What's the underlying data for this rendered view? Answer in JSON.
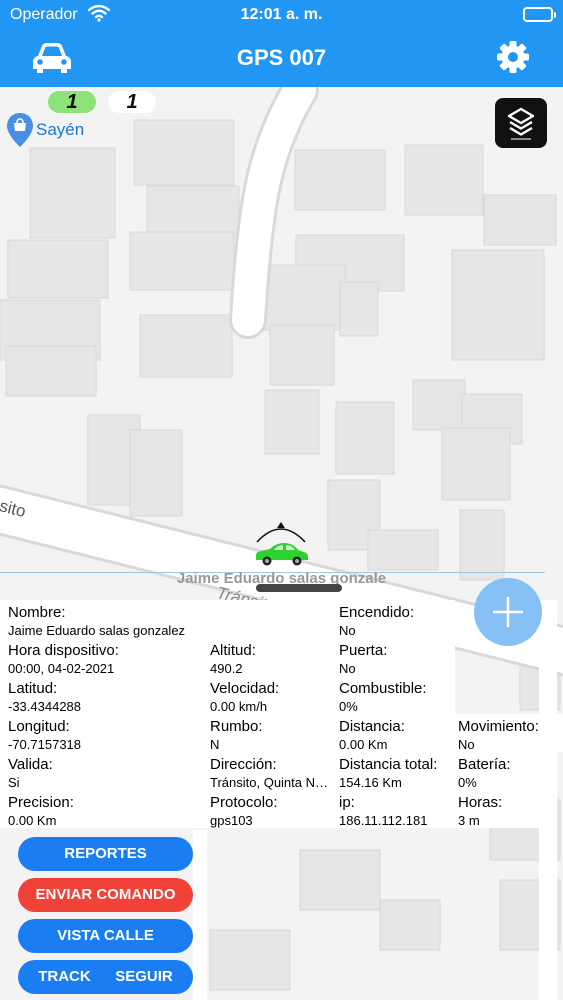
{
  "status": {
    "carrier": "Operador",
    "time": "12:01 a. m."
  },
  "nav": {
    "title": "GPS 007",
    "left_icon": "car-icon",
    "right_icon": "gear-icon"
  },
  "map": {
    "route_chips": [
      "1",
      "1"
    ],
    "poi_label": "Sayén",
    "street_labels": [
      "nsito",
      "Tránsito"
    ],
    "layers_icon": "layers-icon",
    "vehicle_icon": "car-icon"
  },
  "driver_name_label": "Jaime Eduardo salas gonzale",
  "info": {
    "nombre_label": "Nombre:",
    "nombre_value": "Jaime Eduardo salas gonzalez",
    "encendido_label": "Encendido:",
    "encendido_value": "No",
    "hora_label": "Hora dispositivo:",
    "hora_value": "00:00, 04-02-2021",
    "altitud_label": "Altitud:",
    "altitud_value": "490.2",
    "puerta_label": "Puerta:",
    "puerta_value": "No",
    "latitud_label": "Latitud:",
    "latitud_value": "-33.4344288",
    "velocidad_label": "Velocidad:",
    "velocidad_value": "0.00 km/h",
    "combustible_label": "Combustible:",
    "combustible_value": "0%",
    "longitud_label": "Longitud:",
    "longitud_value": "-70.7157318",
    "rumbo_label": "Rumbo:",
    "rumbo_value": "N",
    "distancia_label": "Distancia:",
    "distancia_value": "0.00 Km",
    "movimiento_label": "Movimiento:",
    "movimiento_value": "No",
    "valida_label": "Valida:",
    "valida_value": "Si",
    "direccion_label": "Dirección:",
    "direccion_value": "Tránsito, Quinta Normal, Región Metropolitana",
    "distancia_total_label": "Distancia total:",
    "distancia_total_value": "154.16 Km",
    "bateria_label": "Batería:",
    "bateria_value": "0%",
    "precision_label": "Precision:",
    "precision_value": "0.00 Km",
    "protocolo_label": "Protocolo:",
    "protocolo_value": "gps103",
    "ip_label": "ip:",
    "ip_value": "186.11.112.181",
    "horas_label": "Horas:",
    "horas_value": "3 m"
  },
  "buttons": {
    "reportes": "REPORTES",
    "enviar_comando": "ENVIAR COMANDO",
    "vista_calle": "VISTA CALLE",
    "track": "TRACK",
    "seguir": "SEGUIR"
  },
  "colors": {
    "primary": "#2196f3",
    "button_blue": "#1a7ef2",
    "button_red": "#f1423a",
    "vehicle_green": "#2fd12f",
    "fab": "#86c0f4"
  }
}
